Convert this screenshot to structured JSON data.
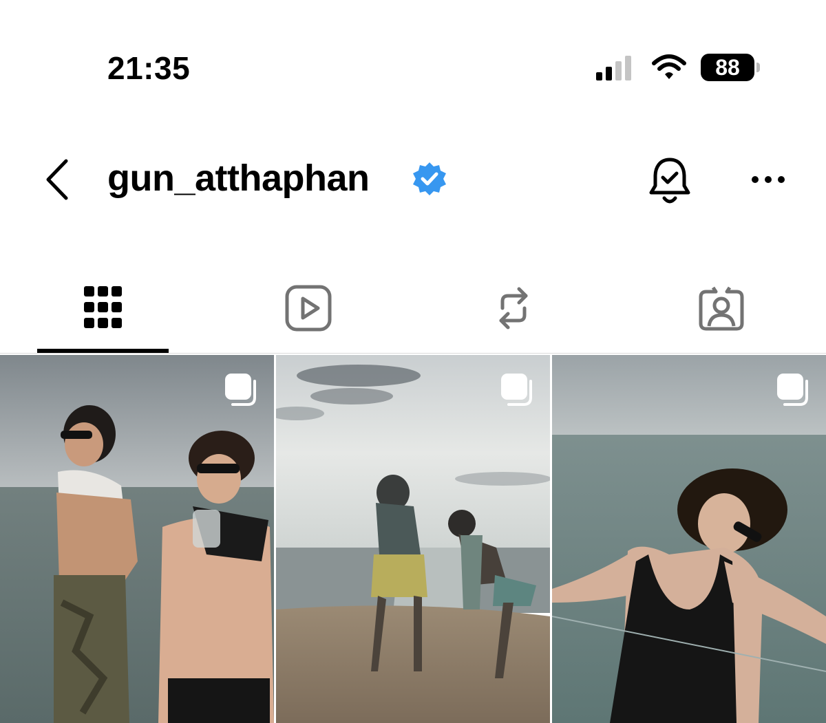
{
  "status_bar": {
    "time": "21:35",
    "battery": "88",
    "icons": [
      "cellular-signal-icon",
      "wifi-icon",
      "battery-icon"
    ]
  },
  "header": {
    "username": "gun_atthaphan",
    "icons": [
      "back-chevron-icon",
      "verified-badge-icon",
      "bell-notification-icon",
      "more-options-icon"
    ]
  },
  "tabs": [
    {
      "name": "posts",
      "icon": "grid-icon",
      "active": true
    },
    {
      "name": "reels",
      "icon": "reels-play-icon",
      "active": false
    },
    {
      "name": "reposts",
      "icon": "repost-icon",
      "active": false
    },
    {
      "name": "tagged",
      "icon": "tagged-person-icon",
      "active": false
    }
  ],
  "posts": [
    {
      "type": "carousel",
      "icon": "multiple-photos-icon"
    },
    {
      "type": "carousel",
      "icon": "multiple-photos-icon"
    },
    {
      "type": "carousel",
      "icon": "multiple-photos-icon"
    }
  ],
  "colors": {
    "verified_blue": "#3797f0",
    "tab_icon_gray": "#737373",
    "active_black": "#000000",
    "divider": "#dbdbdb"
  }
}
